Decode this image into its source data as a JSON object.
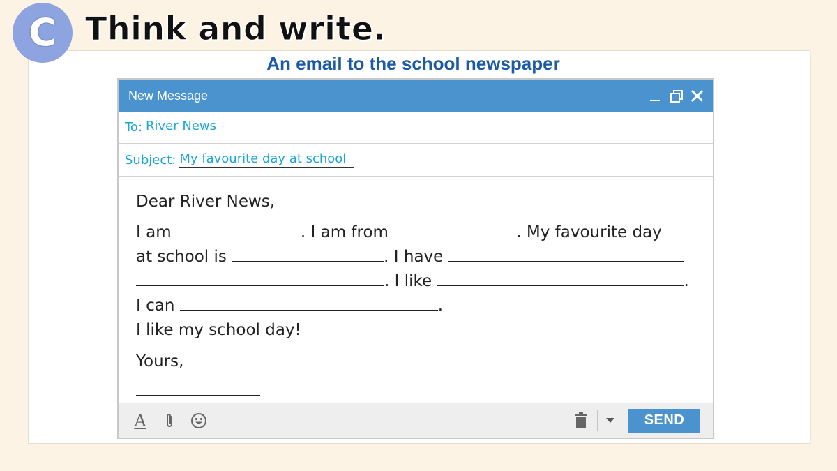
{
  "activity": {
    "badge_letter": "C",
    "title": "Think and write.",
    "subheading": "An email to the school newspaper"
  },
  "window": {
    "title": "New Message",
    "icons": [
      "minimize-icon",
      "restore-icon",
      "close-icon"
    ]
  },
  "fields": {
    "to_label": "To:",
    "to_value": "River News",
    "subject_label": "Subject:",
    "subject_value": "My favourite day at school"
  },
  "body": {
    "greeting": "Dear River News,",
    "line1_a": "I am",
    "line1_b": ". I am from",
    "line1_c": ". My favourite day",
    "line2_a": "at school is",
    "line2_b": ". I have",
    "line3_a": ". I like",
    "line3_b": ".",
    "line4_a": "I can",
    "line4_b": ".",
    "line5": "I like my school day!",
    "closing": "Yours,"
  },
  "toolbar": {
    "format_glyph": "A",
    "icons": [
      "format-text-icon",
      "attachment-icon",
      "emoji-icon",
      "trash-icon",
      "caret-down-icon"
    ],
    "send_label": "SEND"
  },
  "colors": {
    "titlebar": "#4a93cf",
    "field_text": "#1aa6d6",
    "subheading": "#1a5aa6",
    "badge": "#8ea4e0",
    "background": "#fdf3e4"
  }
}
